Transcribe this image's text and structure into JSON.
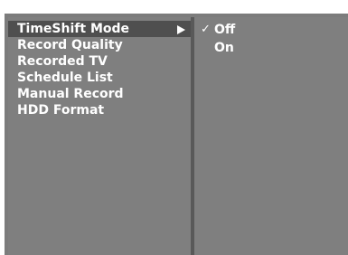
{
  "menu": {
    "items": [
      {
        "label": "TimeShift Mode",
        "selected": true,
        "has_submenu": true
      },
      {
        "label": "Record Quality"
      },
      {
        "label": "Recorded TV"
      },
      {
        "label": "Schedule List"
      },
      {
        "label": "Manual Record"
      },
      {
        "label": "HDD Format"
      }
    ]
  },
  "submenu": {
    "options": [
      {
        "label": "Off",
        "checked": true
      },
      {
        "label": "On",
        "checked": false
      }
    ],
    "check_glyph": "✓"
  },
  "colors": {
    "panel_bg": "#7f7f7f",
    "highlight_bg": "#4f4f4f",
    "divider": "#595959",
    "text": "#ffffff"
  }
}
